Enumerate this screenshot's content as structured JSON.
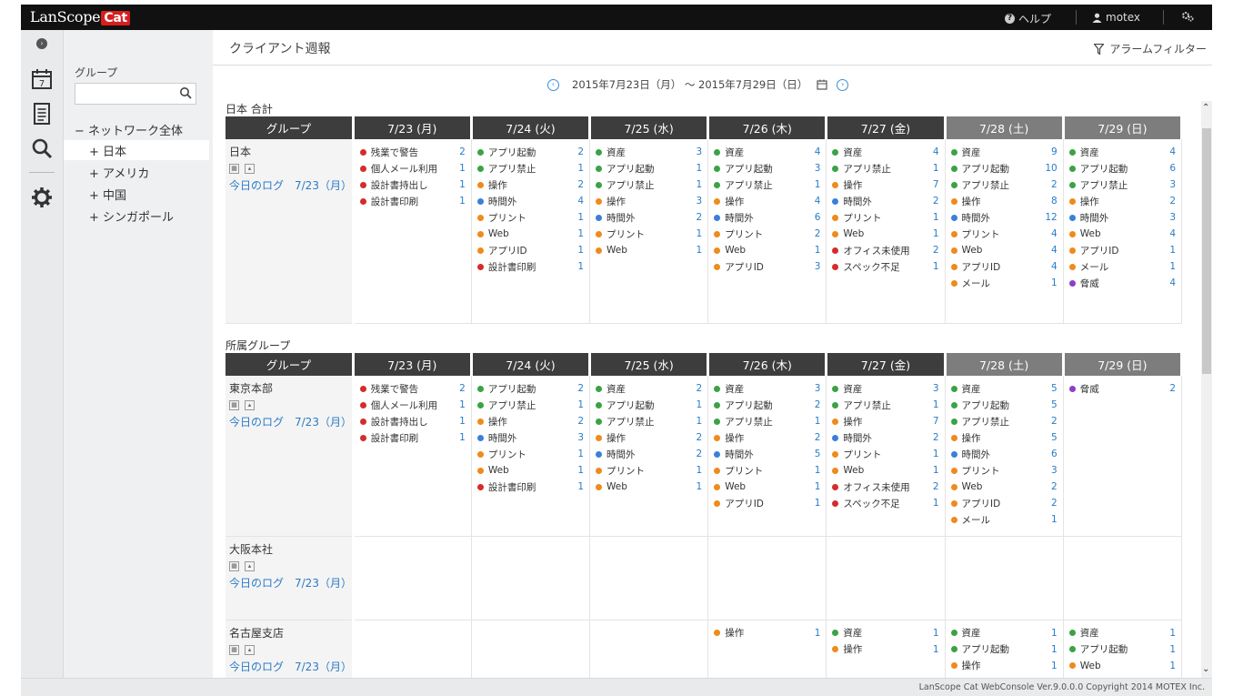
{
  "topbar": {
    "logo_main": "LanScope",
    "logo_badge": "Cat",
    "help_label": "ヘルプ",
    "user_label": "motex"
  },
  "sidebar": {
    "group_label": "グループ",
    "search_placeholder": "",
    "tree": [
      {
        "label": "− ネットワーク全体"
      },
      {
        "label": "+ 日本"
      },
      {
        "label": "+ アメリカ"
      },
      {
        "label": "+ 中国"
      },
      {
        "label": "+ シンガポール"
      }
    ]
  },
  "main": {
    "title": "クライアント週報",
    "alarm_filter": "アラームフィルター",
    "date_range": "2015年7月23日（月） ～ 2015年7月29日（日）"
  },
  "colors": {
    "green": "#3aa345",
    "red": "#d62b2b",
    "orange": "#f08a1a",
    "blue": "#3b7fd9",
    "purple": "#8a3fc9"
  },
  "headers": {
    "group": "グループ",
    "days": [
      "7/23 (月)",
      "7/24 (火)",
      "7/25 (水)",
      "7/26 (木)",
      "7/27 (金)",
      "7/28 (土)",
      "7/29 (日)"
    ],
    "weekend": [
      false,
      false,
      false,
      false,
      false,
      true,
      true
    ]
  },
  "sections": [
    {
      "label": "日本 合計",
      "rows": [
        {
          "name": "日本",
          "log": "今日のログ　7/23（月）",
          "days": [
            [
              [
                "red",
                "残業で警告",
                "2"
              ],
              [
                "red",
                "個人メール利用",
                "1"
              ],
              [
                "red",
                "設計書持出し",
                "1"
              ],
              [
                "red",
                "設計書印刷",
                "1"
              ]
            ],
            [
              [
                "green",
                "アプリ起動",
                "2"
              ],
              [
                "green",
                "アプリ禁止",
                "1"
              ],
              [
                "orange",
                "操作",
                "2"
              ],
              [
                "blue",
                "時間外",
                "4"
              ],
              [
                "orange",
                "プリント",
                "1"
              ],
              [
                "orange",
                "Web",
                "1"
              ],
              [
                "orange",
                "アプリID",
                "1"
              ],
              [
                "red",
                "設計書印刷",
                "1"
              ]
            ],
            [
              [
                "green",
                "資産",
                "3"
              ],
              [
                "green",
                "アプリ起動",
                "1"
              ],
              [
                "green",
                "アプリ禁止",
                "1"
              ],
              [
                "orange",
                "操作",
                "3"
              ],
              [
                "blue",
                "時間外",
                "2"
              ],
              [
                "orange",
                "プリント",
                "1"
              ],
              [
                "orange",
                "Web",
                "1"
              ]
            ],
            [
              [
                "green",
                "資産",
                "4"
              ],
              [
                "green",
                "アプリ起動",
                "3"
              ],
              [
                "green",
                "アプリ禁止",
                "1"
              ],
              [
                "orange",
                "操作",
                "4"
              ],
              [
                "blue",
                "時間外",
                "6"
              ],
              [
                "orange",
                "プリント",
                "2"
              ],
              [
                "orange",
                "Web",
                "1"
              ],
              [
                "orange",
                "アプリID",
                "3"
              ]
            ],
            [
              [
                "green",
                "資産",
                "4"
              ],
              [
                "green",
                "アプリ禁止",
                "1"
              ],
              [
                "orange",
                "操作",
                "7"
              ],
              [
                "blue",
                "時間外",
                "2"
              ],
              [
                "orange",
                "プリント",
                "1"
              ],
              [
                "orange",
                "Web",
                "1"
              ],
              [
                "red",
                "オフィス未使用",
                "2"
              ],
              [
                "red",
                "スペック不足",
                "1"
              ]
            ],
            [
              [
                "green",
                "資産",
                "9"
              ],
              [
                "green",
                "アプリ起動",
                "10"
              ],
              [
                "green",
                "アプリ禁止",
                "2"
              ],
              [
                "orange",
                "操作",
                "8"
              ],
              [
                "blue",
                "時間外",
                "12"
              ],
              [
                "orange",
                "プリント",
                "4"
              ],
              [
                "orange",
                "Web",
                "4"
              ],
              [
                "orange",
                "アプリID",
                "4"
              ],
              [
                "orange",
                "メール",
                "1"
              ]
            ],
            [
              [
                "green",
                "資産",
                "4"
              ],
              [
                "green",
                "アプリ起動",
                "6"
              ],
              [
                "green",
                "アプリ禁止",
                "3"
              ],
              [
                "orange",
                "操作",
                "2"
              ],
              [
                "blue",
                "時間外",
                "3"
              ],
              [
                "orange",
                "Web",
                "4"
              ],
              [
                "orange",
                "アプリID",
                "1"
              ],
              [
                "orange",
                "メール",
                "1"
              ],
              [
                "purple",
                "脅威",
                "4"
              ]
            ]
          ]
        }
      ]
    },
    {
      "label": "所属グループ",
      "rows": [
        {
          "name": "東京本部",
          "log": "今日のログ　7/23（月）",
          "days": [
            [
              [
                "red",
                "残業で警告",
                "2"
              ],
              [
                "red",
                "個人メール利用",
                "1"
              ],
              [
                "red",
                "設計書持出し",
                "1"
              ],
              [
                "red",
                "設計書印刷",
                "1"
              ]
            ],
            [
              [
                "green",
                "アプリ起動",
                "2"
              ],
              [
                "green",
                "アプリ禁止",
                "1"
              ],
              [
                "orange",
                "操作",
                "2"
              ],
              [
                "blue",
                "時間外",
                "3"
              ],
              [
                "orange",
                "プリント",
                "1"
              ],
              [
                "orange",
                "Web",
                "1"
              ],
              [
                "red",
                "設計書印刷",
                "1"
              ]
            ],
            [
              [
                "green",
                "資産",
                "2"
              ],
              [
                "green",
                "アプリ起動",
                "1"
              ],
              [
                "green",
                "アプリ禁止",
                "1"
              ],
              [
                "orange",
                "操作",
                "2"
              ],
              [
                "blue",
                "時間外",
                "2"
              ],
              [
                "orange",
                "プリント",
                "1"
              ],
              [
                "orange",
                "Web",
                "1"
              ]
            ],
            [
              [
                "green",
                "資産",
                "3"
              ],
              [
                "green",
                "アプリ起動",
                "2"
              ],
              [
                "green",
                "アプリ禁止",
                "1"
              ],
              [
                "orange",
                "操作",
                "2"
              ],
              [
                "blue",
                "時間外",
                "5"
              ],
              [
                "orange",
                "プリント",
                "1"
              ],
              [
                "orange",
                "Web",
                "1"
              ],
              [
                "orange",
                "アプリID",
                "1"
              ]
            ],
            [
              [
                "green",
                "資産",
                "3"
              ],
              [
                "green",
                "アプリ禁止",
                "1"
              ],
              [
                "orange",
                "操作",
                "7"
              ],
              [
                "blue",
                "時間外",
                "2"
              ],
              [
                "orange",
                "プリント",
                "1"
              ],
              [
                "orange",
                "Web",
                "1"
              ],
              [
                "red",
                "オフィス未使用",
                "2"
              ],
              [
                "red",
                "スペック不足",
                "1"
              ]
            ],
            [
              [
                "green",
                "資産",
                "5"
              ],
              [
                "green",
                "アプリ起動",
                "5"
              ],
              [
                "green",
                "アプリ禁止",
                "2"
              ],
              [
                "orange",
                "操作",
                "5"
              ],
              [
                "blue",
                "時間外",
                "6"
              ],
              [
                "orange",
                "プリント",
                "3"
              ],
              [
                "orange",
                "Web",
                "2"
              ],
              [
                "orange",
                "アプリID",
                "2"
              ],
              [
                "orange",
                "メール",
                "1"
              ]
            ],
            [
              [
                "purple",
                "脅威",
                "2"
              ]
            ]
          ]
        },
        {
          "name": "大阪本社",
          "log": "今日のログ　7/23（月）",
          "days": [
            [],
            [],
            [],
            [],
            [],
            [],
            []
          ]
        },
        {
          "name": "名古屋支店",
          "log": "今日のログ　7/23（月）",
          "days": [
            [],
            [],
            [],
            [
              [
                "orange",
                "操作",
                "1"
              ]
            ],
            [
              [
                "green",
                "資産",
                "1"
              ],
              [
                "orange",
                "操作",
                "1"
              ]
            ],
            [
              [
                "green",
                "資産",
                "1"
              ],
              [
                "green",
                "アプリ起動",
                "1"
              ],
              [
                "orange",
                "操作",
                "1"
              ]
            ],
            [
              [
                "green",
                "資産",
                "1"
              ],
              [
                "green",
                "アプリ起動",
                "1"
              ],
              [
                "orange",
                "Web",
                "1"
              ]
            ]
          ]
        }
      ]
    }
  ],
  "footer": "LanScope Cat WebConsole Ver.9.0.0.0 Copyright 2014 MOTEX Inc."
}
